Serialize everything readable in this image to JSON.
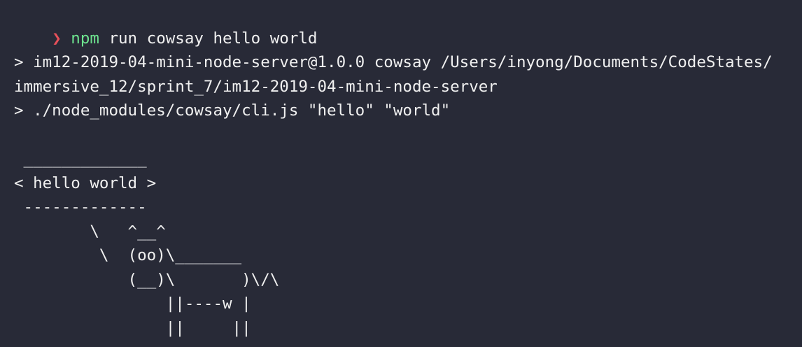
{
  "prompt": {
    "symbol": "❯",
    "command": "npm",
    "args": " run cowsay hello world"
  },
  "output": {
    "lines": [
      "> im12-2019-04-mini-node-server@1.0.0 cowsay /Users/inyong/Documents/CodeStates/",
      "immersive_12/sprint_7/im12-2019-04-mini-node-server",
      "> ./node_modules/cowsay/cli.js \"hello\" \"world\""
    ]
  },
  "cowsay": {
    "lines": [
      " _____________",
      "< hello world >",
      " -------------",
      "        \\   ^__^",
      "         \\  (oo)\\_______",
      "            (__)\\       )\\/\\",
      "                ||----w |",
      "                ||     ||"
    ]
  },
  "colors": {
    "background": "#282a37",
    "prompt_arrow": "#e6505a",
    "command": "#6de38f",
    "text": "#f0f0f0"
  }
}
